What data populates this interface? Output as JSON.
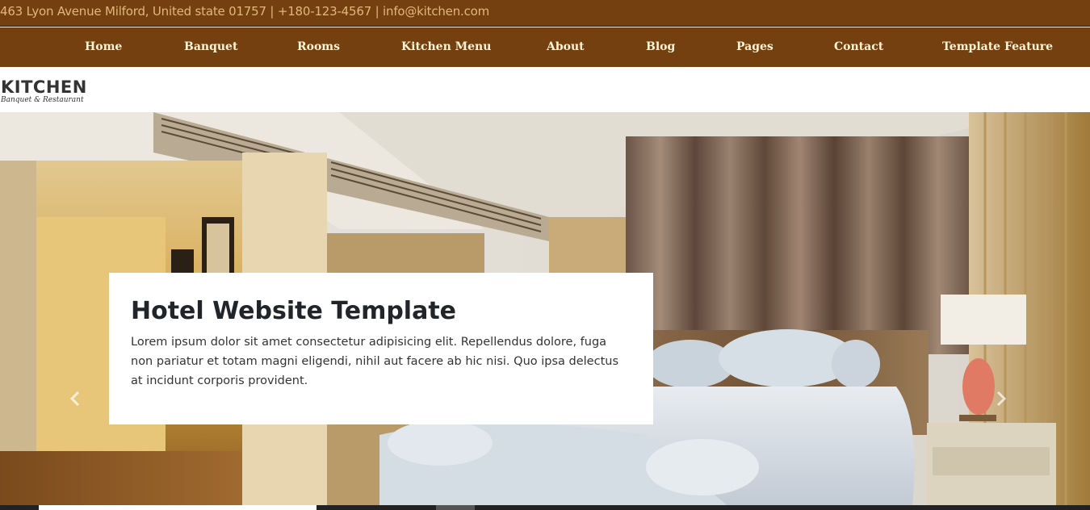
{
  "topbar": {
    "contact_text": "463 Lyon Avenue Milford, United state 01757 | +180-123-4567 | info@kitchen.com"
  },
  "nav": {
    "items": [
      {
        "label": "Home"
      },
      {
        "label": "Banquet"
      },
      {
        "label": "Rooms"
      },
      {
        "label": "Kitchen Menu"
      },
      {
        "label": "About"
      },
      {
        "label": "Blog"
      },
      {
        "label": "Pages"
      },
      {
        "label": "Contact"
      },
      {
        "label": "Template Feature"
      }
    ]
  },
  "logo": {
    "main": "KITCHEN",
    "sub": "Banquet & Restaurant"
  },
  "hero": {
    "title": "Hotel Website Template",
    "text": "Lorem ipsum dolor sit amet consectetur adipisicing elit. Repellendus dolore, fuga non pariatur et totam magni eligendi, nihil aut facere ab hic nisi. Quo ipsa delectus at incidunt corporis provident.",
    "prev_icon": "chevron-left-icon",
    "next_icon": "chevron-right-icon"
  },
  "colors": {
    "brand": "#74400f",
    "nav_text": "#fff4d6",
    "contact_text": "#e0b87a"
  }
}
